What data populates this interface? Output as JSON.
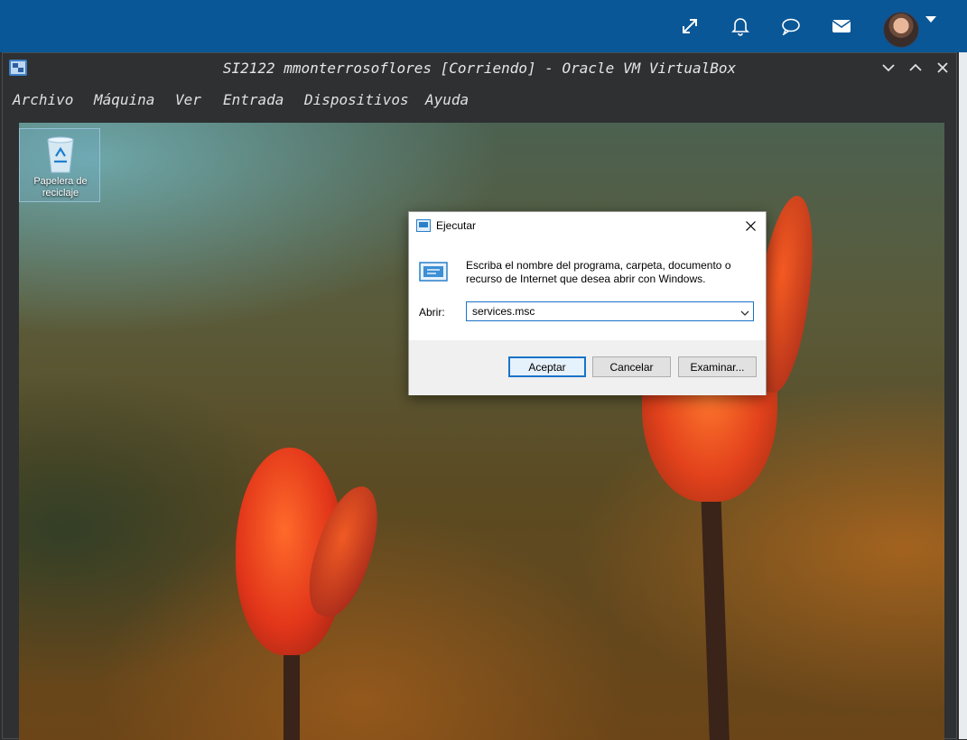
{
  "window": {
    "title": "SI2122 mmonterrosoflores [Corriendo] - Oracle VM VirtualBox"
  },
  "menu": [
    "Archivo",
    "Máquina",
    "Ver",
    "Entrada",
    "Dispositivos",
    "Ayuda"
  ],
  "host_icons": [
    "expand-icon",
    "bell-icon",
    "chat-icon",
    "mail-icon"
  ],
  "desktop": {
    "recycle_bin_label": "Papelera de reciclaje"
  },
  "run_dialog": {
    "title": "Ejecutar",
    "description": "Escriba el nombre del programa, carpeta, documento o recurso de Internet que desea abrir con Windows.",
    "open_label": "Abrir:",
    "input_value": "services.msc",
    "buttons": {
      "ok": "Aceptar",
      "cancel": "Cancelar",
      "browse": "Examinar..."
    }
  },
  "colors": {
    "host_bar": "#0a5797",
    "accent": "#1a73c8"
  }
}
